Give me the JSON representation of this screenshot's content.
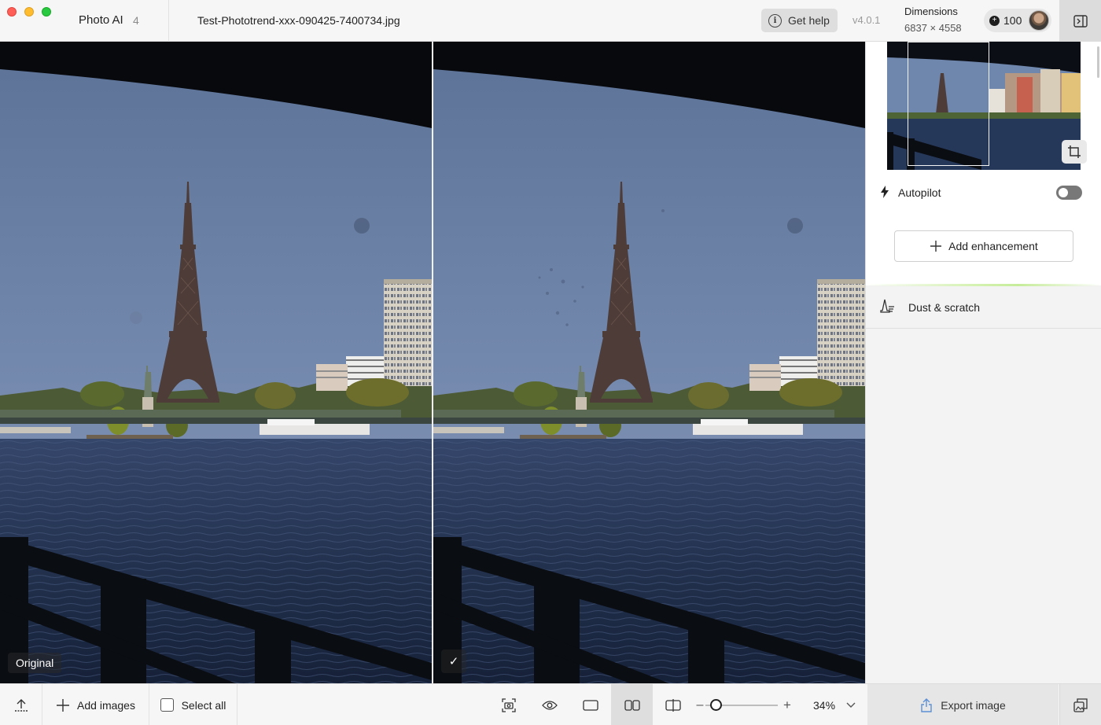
{
  "app": {
    "name": "Photo AI",
    "version_badge": "4",
    "filename": "Test-Phototrend-xxx-090425-7400734.jpg",
    "help_label": "Get help",
    "version": "v4.0.1",
    "dimensions_label": "Dimensions",
    "dimensions_value": "6837 × 4558",
    "credits": "100"
  },
  "viewer": {
    "left_label": "Original",
    "right_label": "✓"
  },
  "panel": {
    "autopilot_label": "Autopilot",
    "autopilot_enabled": false,
    "add_enhancement_label": "Add enhancement",
    "enhancements": [
      {
        "label": "Dust & scratch"
      }
    ]
  },
  "toolbar": {
    "add_images_label": "Add images",
    "select_all_label": "Select all",
    "zoom_value": "34%",
    "zoom_level": 0.16,
    "export_label": "Export image",
    "active_view": "side-by-side"
  },
  "icons": {
    "upload": "upload-icon",
    "plus": "plus-icon",
    "screenshot": "camera-frame-icon",
    "eye": "eye-icon",
    "single_view": "single-view-icon",
    "side_by_side": "side-by-side-icon",
    "split_view": "split-view-icon",
    "chevron": "chevron-down-icon",
    "export": "share-icon",
    "batch": "batch-images-icon",
    "crop": "crop-icon",
    "bolt": "bolt-icon",
    "dust": "broom-icon",
    "panel_toggle": "sidebar-toggle-icon"
  },
  "colors": {
    "traffic_red": "#ff5f57",
    "traffic_yellow": "#febc2e",
    "traffic_green": "#28c840",
    "accent_glow": "#c6ec9a"
  }
}
